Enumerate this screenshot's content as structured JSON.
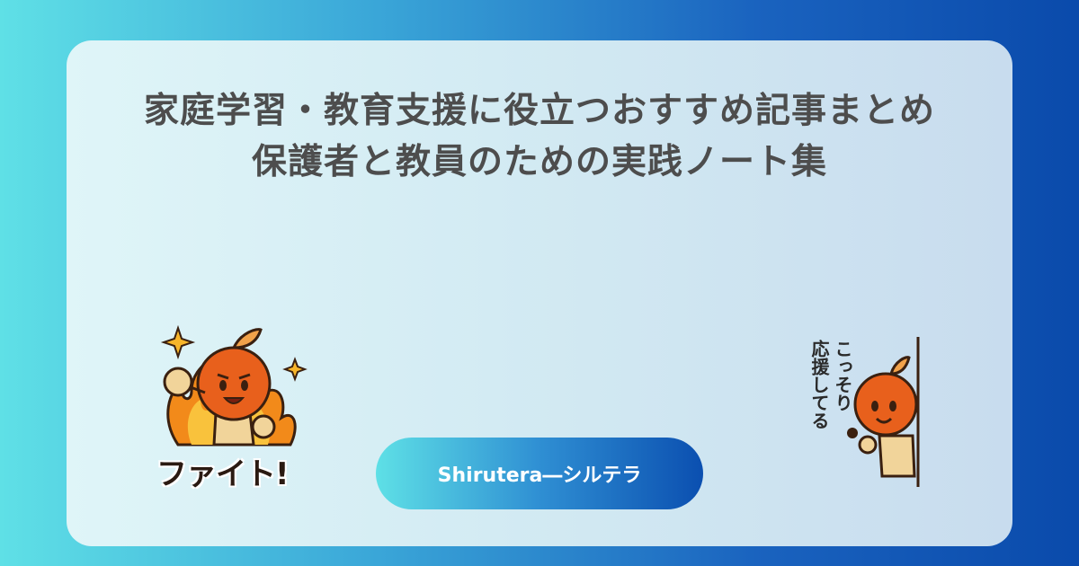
{
  "title": {
    "line1": "家庭学習・教育支援に役立つおすすめ記事まとめ",
    "line2": "保護者と教員のための実践ノート集"
  },
  "brand": {
    "label": "Shirutera―シルテラ"
  },
  "sticker_left": {
    "text": "ファイト!",
    "icon": "fighting-mascot-flame-sticker"
  },
  "sticker_right": {
    "line1": "こっそり",
    "line2": "応援してる",
    "icon": "peeking-mascot-sticker"
  },
  "colors": {
    "bg_start": "#5fe0e6",
    "bg_end": "#0a4aab",
    "title": "#4d4d4d",
    "mascot": "#e8601c",
    "flame": "#f28a1a"
  }
}
